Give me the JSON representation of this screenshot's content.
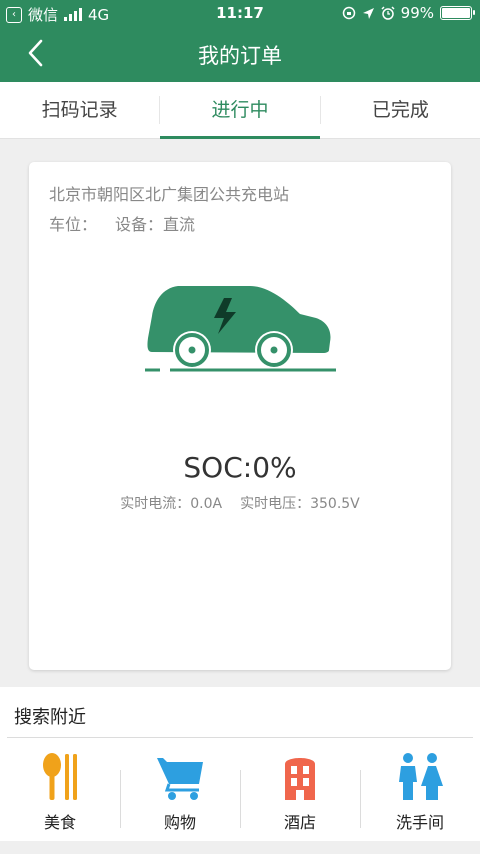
{
  "status_bar": {
    "carrier": "微信",
    "network": "4G",
    "time": "11:17",
    "battery": "99%",
    "battery_level": 0.99
  },
  "nav": {
    "title": "我的订单"
  },
  "tabs": [
    {
      "label": "扫码记录",
      "active": false
    },
    {
      "label": "进行中",
      "active": true
    },
    {
      "label": "已完成",
      "active": false
    }
  ],
  "order": {
    "station": "北京市朝阳区北广集团公共充电站",
    "slot_label": "车位：",
    "device_label": "设备：直流",
    "soc": "SOC:0%",
    "current": "实时电流：0.0A",
    "voltage": "实时电压：350.5V"
  },
  "nearby": {
    "title": "搜索附近",
    "items": [
      {
        "label": "美食",
        "icon": "fork-spoon-icon",
        "color": "#f0a21a"
      },
      {
        "label": "购物",
        "icon": "shopping-cart-icon",
        "color": "#2d9fe0"
      },
      {
        "label": "酒店",
        "icon": "hotel-icon",
        "color": "#f0664c"
      },
      {
        "label": "洗手间",
        "icon": "restroom-icon",
        "color": "#2d9fe0"
      }
    ]
  },
  "colors": {
    "brand": "#2e8b5f",
    "car": "#35916a"
  }
}
